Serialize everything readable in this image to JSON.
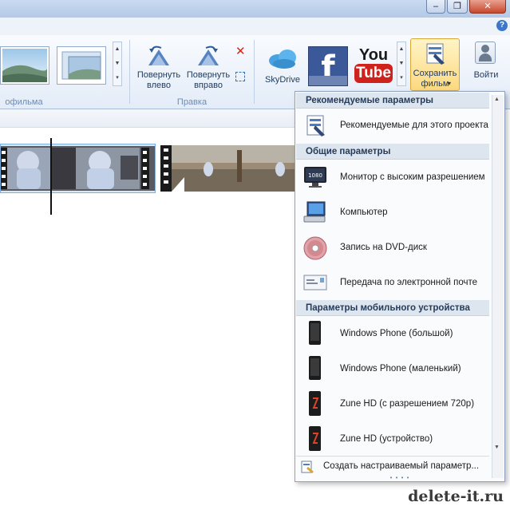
{
  "window": {
    "minimize_glyph": "‒",
    "maximize_glyph": "❐",
    "close_glyph": "✕",
    "help_glyph": "?"
  },
  "ribbon": {
    "groups": {
      "film_tail": "офильма",
      "edit": "Правка"
    },
    "rotate_left": "Повернуть влево",
    "rotate_right": "Повернуть вправо",
    "share": {
      "skydrive": "SkyDrive",
      "facebook_logo": "f",
      "youtube_logo_1": "You",
      "youtube_logo_2": "Tube"
    },
    "save_movie": "Сохранить фильм",
    "sign_in": "Войти"
  },
  "menu": {
    "sections": {
      "recommended": "Рекомендуемые параметры",
      "general": "Общие параметры",
      "mobile": "Параметры мобильного устройства"
    },
    "items": {
      "recommended_project": "Рекомендуемые для этого проекта",
      "hd_monitor": "Монитор с высоким разрешением",
      "computer": "Компьютер",
      "dvd": "Запись на DVD-диск",
      "email": "Передача по электронной почте",
      "wp_large": "Windows Phone (большой)",
      "wp_small": "Windows Phone (маленький)",
      "zune_720": "Zune HD (с разрешением 720p)",
      "zune_device": "Zune HD (устройство)",
      "custom": "Создать настраиваемый параметр..."
    },
    "icons": {
      "hd_badge": "1080"
    }
  },
  "watermark": "delete-it.ru",
  "colors": {
    "youtube_red": "#d0221c",
    "facebook_blue": "#3b5998",
    "save_highlight": "#fde9a8",
    "section_header": "#dde5ef"
  }
}
